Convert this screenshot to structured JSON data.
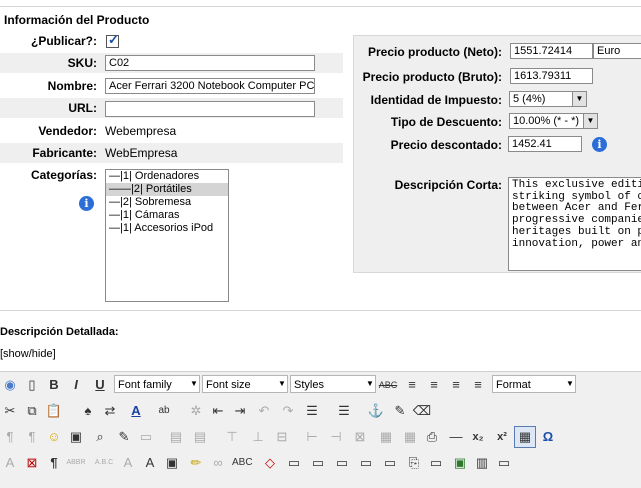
{
  "section": {
    "title": "Información del Producto"
  },
  "left": {
    "publicar_label": "¿Publicar?:",
    "sku_label": "SKU:",
    "sku_value": "C02",
    "nombre_label": "Nombre:",
    "nombre_value": "Acer Ferrari 3200 Notebook Computer PC",
    "url_label": "URL:",
    "url_value": "",
    "vendedor_label": "Vendedor:",
    "vendedor_value": "Webempresa",
    "fabricante_label": "Fabricante:",
    "fabricante_value": "WebEmpresa",
    "categorias_label": "Categorías:",
    "categories": [
      "—|1| Ordenadores",
      "——|2| Portátiles",
      "—|2| Sobremesa",
      "—|1| Cámaras",
      "—|1| Accesorios iPod"
    ]
  },
  "right": {
    "neto_label": "Precio producto (Neto):",
    "neto_value": "1551.72414",
    "currency": "Euro",
    "bruto_label": "Precio producto (Bruto):",
    "bruto_value": "1613.79311",
    "impuesto_label": "Identidad de Impuesto:",
    "impuesto_value": "5 (4%)",
    "descuento_label": "Tipo de Descuento:",
    "descuento_value": "10.00% (* - *)",
    "descontado_label": "Precio descontado:",
    "descontado_value": "1452.41",
    "desc_corta_label": "Descripción Corta:",
    "desc_corta_value": "This exclusive editi\nstriking symbol of c\nbetween Acer and Fer\nprogressive companie\nheritages built on p\ninnovation, power an"
  },
  "detail": {
    "title": "Descripción Detallada:",
    "showhide": "[show/hide]"
  },
  "toolbar": {
    "font_family": "Font family",
    "font_size": "Font size",
    "styles": "Styles",
    "format": "Format"
  },
  "colors": {
    "panel_bg": "#efefef",
    "info_blue": "#2a6ed6",
    "selected_row": "#d4d4d4"
  }
}
